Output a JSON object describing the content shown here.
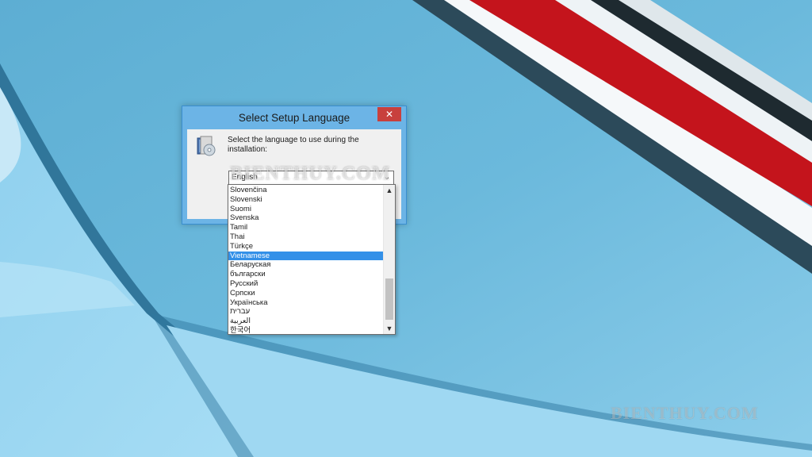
{
  "dialog": {
    "title": "Select Setup Language",
    "prompt": "Select the language to use during the installation:",
    "selected_language": "English"
  },
  "language_list": {
    "items": [
      "Slovenčina",
      "Slovenski",
      "Suomi",
      "Svenska",
      "Tamil",
      "Thai",
      "Türkçe",
      "Vietnamese",
      "Беларуская",
      "български",
      "Русский",
      "Српски",
      "Українська",
      "עברית",
      "العربية",
      "한국어"
    ],
    "highlighted": "Vietnamese"
  },
  "watermarks": {
    "dialog": "BIENTHUY.COM",
    "bottom": "BIENTHUY.COM"
  },
  "icons": {
    "close": "close-icon",
    "setup": "setup-icon",
    "combo_arrow": "chevron-down-icon",
    "scroll_up": "chevron-up-icon",
    "scroll_down": "chevron-down-icon"
  },
  "colors": {
    "title_bar": "#6cb4e6",
    "close_button": "#c8403d",
    "selection": "#3390e8",
    "wallpaper": "#6ab7d9"
  }
}
